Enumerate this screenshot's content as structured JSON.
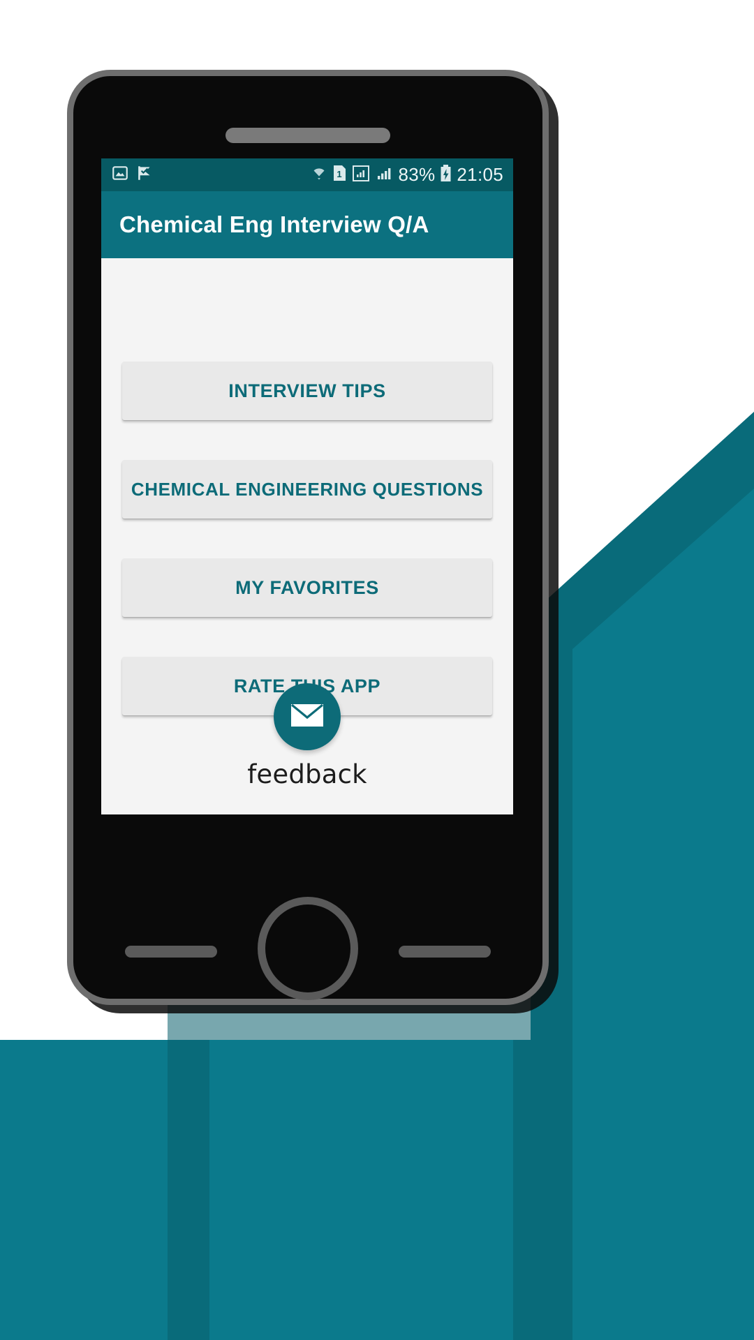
{
  "theme": {
    "accent_teal": "#0c7180",
    "statusbar_teal": "#075a63",
    "backdrop_teal": "#0b7a8c",
    "backdrop_teal_dark": "#0a5f6b",
    "button_face": "#e9e9e9",
    "button_text": "#0d6b78",
    "screen_background": "#f4f4f4",
    "device_body": "#0a0a0a",
    "device_bezel": "#6e6e6e"
  },
  "status_bar": {
    "left_icons": [
      "image-icon",
      "flag-check-icon"
    ],
    "right_icons": [
      "wifi-icon",
      "sim-1-icon",
      "signal-boxed-icon",
      "signal-bars-icon",
      "battery-charging-icon"
    ],
    "battery_percent": "83%",
    "time": "21:05"
  },
  "app_bar": {
    "title": "Chemical Eng Interview Q/A"
  },
  "main": {
    "buttons": [
      {
        "label": "INTERVIEW TIPS",
        "name": "interview-tips-button"
      },
      {
        "label": "CHEMICAL ENGINEERING QUESTIONS",
        "name": "chemical-engineering-questions-button"
      },
      {
        "label": "MY FAVORITES",
        "name": "my-favorites-button"
      },
      {
        "label": "RATE THIS APP",
        "name": "rate-this-app-button"
      }
    ],
    "feedback": {
      "label": "feedback",
      "icon": "envelope-icon"
    }
  },
  "device": {
    "earpiece": "speaker-grille",
    "home_button": "home-button",
    "capacitive_keys": [
      "recents-key",
      "back-key"
    ]
  }
}
